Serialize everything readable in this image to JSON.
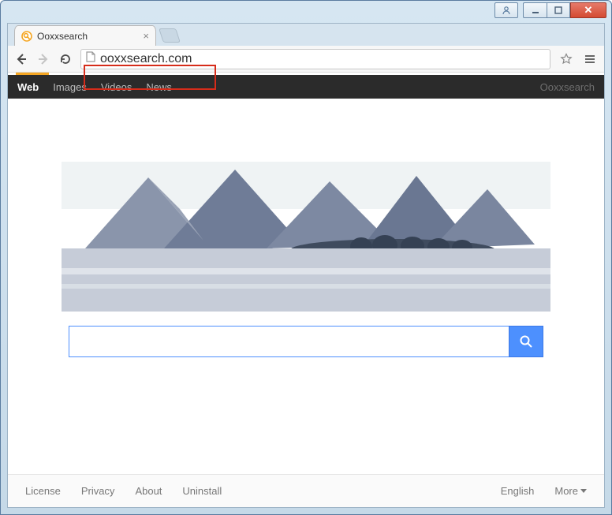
{
  "window": {
    "tab_title": "Ooxxsearch",
    "url": "ooxxsearch.com"
  },
  "menubar": {
    "items": [
      "Web",
      "Images",
      "Videos",
      "News"
    ],
    "active_index": 0,
    "brand": "Ooxxsearch"
  },
  "search": {
    "value": "",
    "placeholder": ""
  },
  "footer": {
    "links": [
      "License",
      "Privacy",
      "About",
      "Uninstall"
    ],
    "language": "English",
    "more_label": "More"
  },
  "highlight": {
    "present": true,
    "target": "address-bar"
  },
  "colors": {
    "accent": "#f5a623",
    "search_button": "#4d90fe",
    "menubar_bg": "#2b2b2b",
    "highlight_border": "#d62c1a"
  }
}
